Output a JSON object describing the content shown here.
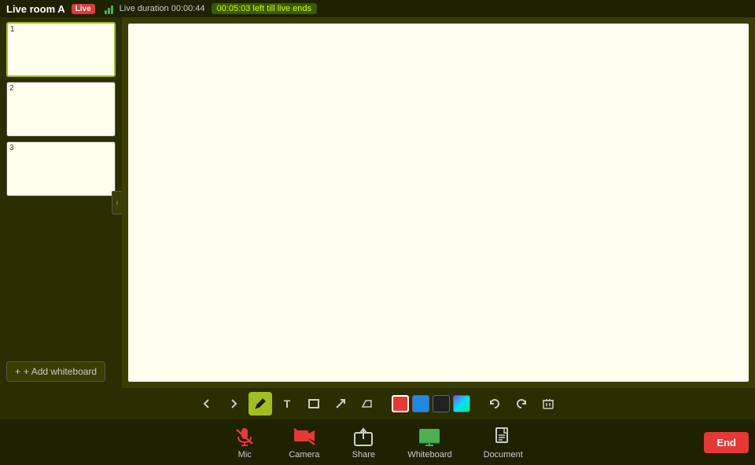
{
  "header": {
    "room_title": "Live room A",
    "live_badge": "Live",
    "duration_label": "Live duration 00:00:44",
    "time_left": "00:05:03 left till live ends"
  },
  "slides": [
    {
      "num": "1",
      "active": true
    },
    {
      "num": "2",
      "active": false
    },
    {
      "num": "3",
      "active": false
    }
  ],
  "toolbar": {
    "prev_label": "←",
    "next_label": "→",
    "pen_label": "✏",
    "text_label": "T",
    "rect_label": "□",
    "arrow_label": "↗",
    "eraser_label": "◇",
    "colors": [
      "#e53935",
      "#1e88e5",
      "#212121",
      "#7c4dff"
    ],
    "undo_label": "↺",
    "redo_label": "↻",
    "delete_label": "🗑"
  },
  "bottom_bar": {
    "mic_label": "Mic",
    "camera_label": "Camera",
    "share_label": "Share",
    "whiteboard_label": "Whiteboard",
    "document_label": "Document",
    "end_label": "End",
    "add_whiteboard_label": "+ Add whiteboard"
  }
}
